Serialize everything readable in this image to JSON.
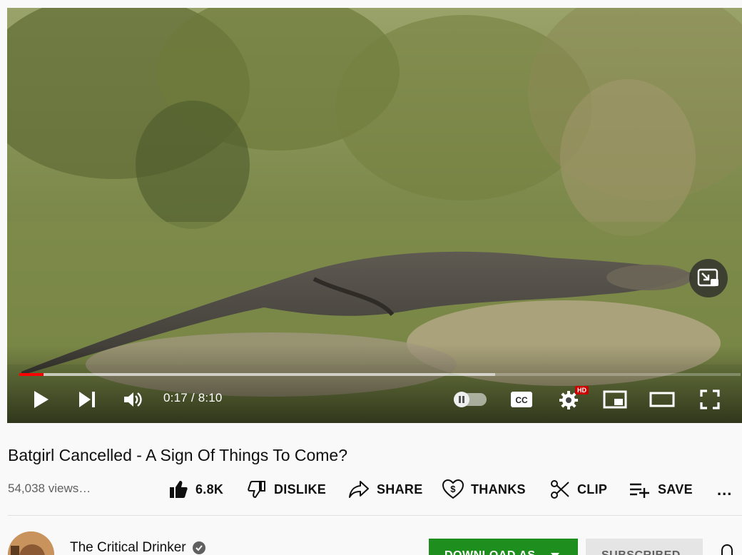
{
  "player": {
    "time_current": "0:17",
    "time_separator": "/",
    "time_total": "8:10",
    "progress_fraction": 0.034,
    "buffered_fraction": 0.66,
    "hd_badge": "HD",
    "cc_label": "CC",
    "icons": [
      "play-icon",
      "next-icon",
      "volume-icon",
      "autoplay-toggle",
      "captions-icon",
      "settings-icon",
      "miniplayer-icon",
      "theater-icon",
      "fullscreen-icon",
      "picture-in-picture-icon"
    ],
    "accent_color": "#ff0000"
  },
  "video": {
    "title": "Batgirl Cancelled - A Sign Of Things To Come?",
    "views": "54,038 views…"
  },
  "actions": {
    "like": "6.8K",
    "dislike": "DISLIKE",
    "share": "SHARE",
    "thanks": "THANKS",
    "clip": "CLIP",
    "save": "SAVE",
    "more": "..."
  },
  "channel": {
    "name": "The Critical Drinker",
    "download_label": "DOWNLOAD AS",
    "subscribed_label": "SUBSCRIBED",
    "download_color": "#1e8e1e"
  }
}
